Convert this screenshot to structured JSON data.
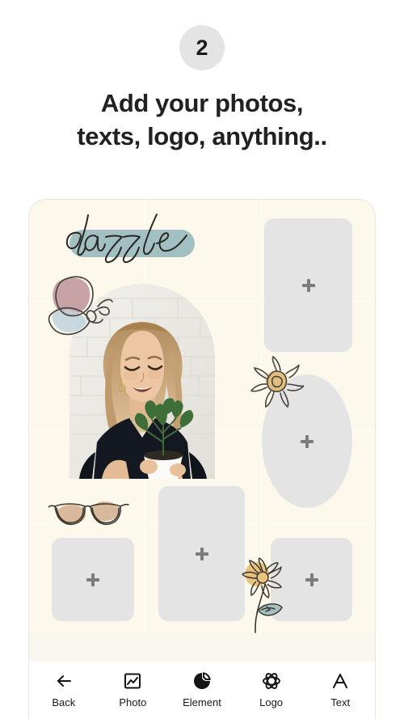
{
  "header": {
    "step_number": "2",
    "headline_line1": "Add your photos,",
    "headline_line2": "texts, logo, anything.."
  },
  "canvas": {
    "background_color": "#fdf8ec",
    "title_text": "dazzle",
    "highlight_color": "#a2c0c1",
    "placeholder_color": "#e4e4e4",
    "plus_color": "#7c7c7c",
    "placeholders": [
      {
        "name": "photo-slot-top-right",
        "shape": "rect",
        "plus": "+"
      },
      {
        "name": "photo-slot-right-oval",
        "shape": "oval",
        "plus": "+"
      },
      {
        "name": "photo-slot-bottom-left",
        "shape": "rect",
        "plus": "+"
      },
      {
        "name": "photo-slot-bottom-center",
        "shape": "rect",
        "plus": "+"
      },
      {
        "name": "photo-slot-bottom-right",
        "shape": "rect",
        "plus": "+"
      }
    ],
    "stickers": [
      {
        "name": "butterfly-sticker",
        "wing_color": "#c6a2a4",
        "lower_wing_color": "#bfd2dd"
      },
      {
        "name": "sun-sticker",
        "center_color": "#dfbe7e"
      },
      {
        "name": "sunglasses-sticker",
        "blob_color": "#d9b99b"
      },
      {
        "name": "flower-sticker",
        "bloom_color": "#e8c37e",
        "leaf_color": "#a2c0c1"
      }
    ],
    "photo": {
      "name": "user-photo",
      "description": "woman holding potted plant"
    }
  },
  "toolbar": {
    "items": [
      {
        "label": "Back",
        "icon": "arrow-left-icon"
      },
      {
        "label": "Photo",
        "icon": "image-icon"
      },
      {
        "label": "Element",
        "icon": "pie-circle-icon"
      },
      {
        "label": "Logo",
        "icon": "atom-flower-icon"
      },
      {
        "label": "Text",
        "icon": "letter-a-icon"
      }
    ]
  }
}
